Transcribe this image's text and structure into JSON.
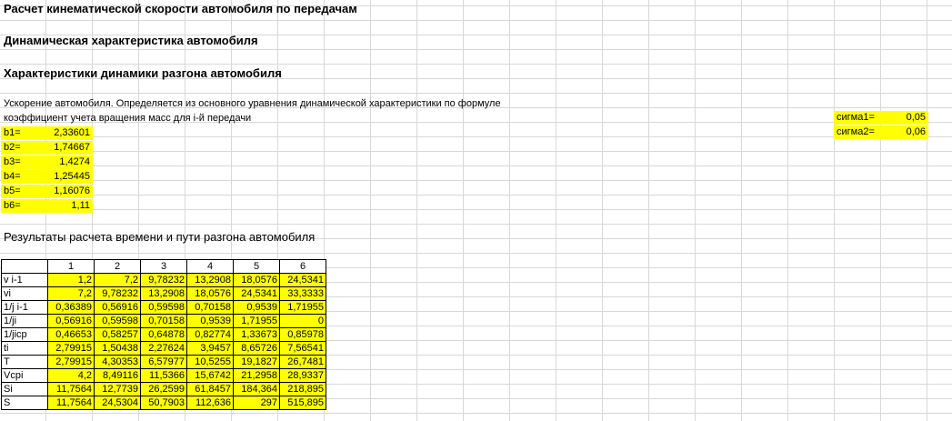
{
  "headings": {
    "h1": "Расчет кинематической скорости автомобиля по передачам",
    "h2": "Динамическая характеристика автомобиля",
    "h3": "Характеристики динамики разгона автомобиля"
  },
  "text": {
    "accel_line": "Ускорение автомобиля. Определяется из основного уравнения динамической характеристики по формуле",
    "coef_line": "коэффициент учета вращения масс для i-й передачи",
    "results_title": "Результаты расчета времени и пути разгона автомобиля"
  },
  "b_params": [
    {
      "label": "b1=",
      "value": "2,33601"
    },
    {
      "label": "b2=",
      "value": "1,74667"
    },
    {
      "label": "b3=",
      "value": "1,4274"
    },
    {
      "label": "b4=",
      "value": "1,25445"
    },
    {
      "label": "b5=",
      "value": "1,16076"
    },
    {
      "label": "b6=",
      "value": "1,11"
    }
  ],
  "sigma": [
    {
      "label": "сигма1=",
      "value": "0,05"
    },
    {
      "label": "сигма2=",
      "value": "0,06"
    }
  ],
  "table": {
    "columns": [
      "1",
      "2",
      "3",
      "4",
      "5",
      "6"
    ],
    "rows": [
      {
        "label": "v i-1",
        "values": [
          "1,2",
          "7,2",
          "9,78232",
          "13,2908",
          "18,0576",
          "24,5341"
        ]
      },
      {
        "label": "vi",
        "values": [
          "7,2",
          "9,78232",
          "13,2908",
          "18,0576",
          "24,5341",
          "33,3333"
        ]
      },
      {
        "label": "1/j i-1",
        "values": [
          "0,36389",
          "0,56916",
          "0,59598",
          "0,70158",
          "0,9539",
          "1,71955"
        ]
      },
      {
        "label": "1/ji",
        "values": [
          "0,56916",
          "0,59598",
          "0,70158",
          "0,9539",
          "1,71955",
          "0"
        ]
      },
      {
        "label": "1/jicp",
        "values": [
          "0,46653",
          "0,58257",
          "0,64878",
          "0,82774",
          "1,33673",
          "0,85978"
        ]
      },
      {
        "label": "ti",
        "values": [
          "2,79915",
          "1,50438",
          "2,27624",
          "3,9457",
          "8,65726",
          "7,56541"
        ]
      },
      {
        "label": "T",
        "values": [
          "2,79915",
          "4,30353",
          "6,57977",
          "10,5255",
          "19,1827",
          "26,7481"
        ]
      },
      {
        "label": "Vcpi",
        "values": [
          "4,2",
          "8,49116",
          "11,5366",
          "15,6742",
          "21,2958",
          "28,9337"
        ]
      },
      {
        "label": "Si",
        "values": [
          "11,7564",
          "12,7739",
          "26,2599",
          "61,8457",
          "184,364",
          "218,895"
        ]
      },
      {
        "label": "S",
        "values": [
          "11,7564",
          "24,5304",
          "50,7903",
          "112,636",
          "297",
          "515,895"
        ]
      }
    ]
  }
}
